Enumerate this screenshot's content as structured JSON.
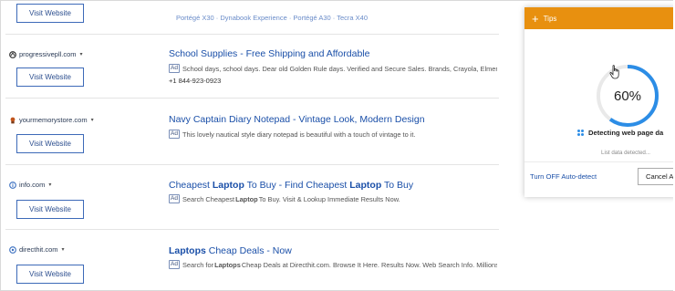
{
  "rows": [
    {
      "visit_label": "Visit Website",
      "sitelinks": "Portégé X30 · Dynabook Experience · Portégé A30 · Tecra X40"
    },
    {
      "site": "progressivepll.com",
      "visit_label": "Visit Website",
      "title": "School Supplies - Free Shipping and Affordable",
      "ad_label": "Ad",
      "desc": "School days, school days. Dear old Golden Rule days. Verified and Secure Sales. Brands, Crayola, Elmer's,",
      "phone": "+1 844-923-0923"
    },
    {
      "site": "yourmemorystore.com",
      "visit_label": "Visit Website",
      "title": "Navy Captain Diary Notepad - Vintage Look, Modern Design",
      "ad_label": "Ad",
      "desc": "This lovely nautical style diary notepad is beautiful with a touch of vintage to it."
    },
    {
      "site": "info.com",
      "visit_label": "Visit Website",
      "title_parts": [
        "Cheapest ",
        "Laptop",
        " To Buy - Find Cheapest ",
        "Laptop",
        " To Buy"
      ],
      "ad_label": "Ad",
      "desc_parts": [
        "Search Cheapest ",
        "Laptop",
        " To Buy. Visit & Lookup Immediate Results Now."
      ]
    },
    {
      "site": "directhit.com",
      "visit_label": "Visit Website",
      "title_parts": [
        "Laptops",
        " Cheap Deals - Now"
      ],
      "ad_label": "Ad",
      "desc_parts": [
        "Search for ",
        "Laptops",
        " Cheap Deals at Directhit.com. Browse It Here. Results Now. Web Search Info. Millions"
      ]
    }
  ],
  "tips": {
    "title": "Tips",
    "progress_percent": 60,
    "progress_text": "60%",
    "detecting": "Detecting web page da",
    "list_data": "List data detected...",
    "turn_off": "Turn OFF Auto-detect",
    "cancel": "Cancel A"
  },
  "colors": {
    "accent_orange": "#e8900f",
    "progress_blue": "#2c8de6",
    "link_blue": "#1a4fa8"
  }
}
